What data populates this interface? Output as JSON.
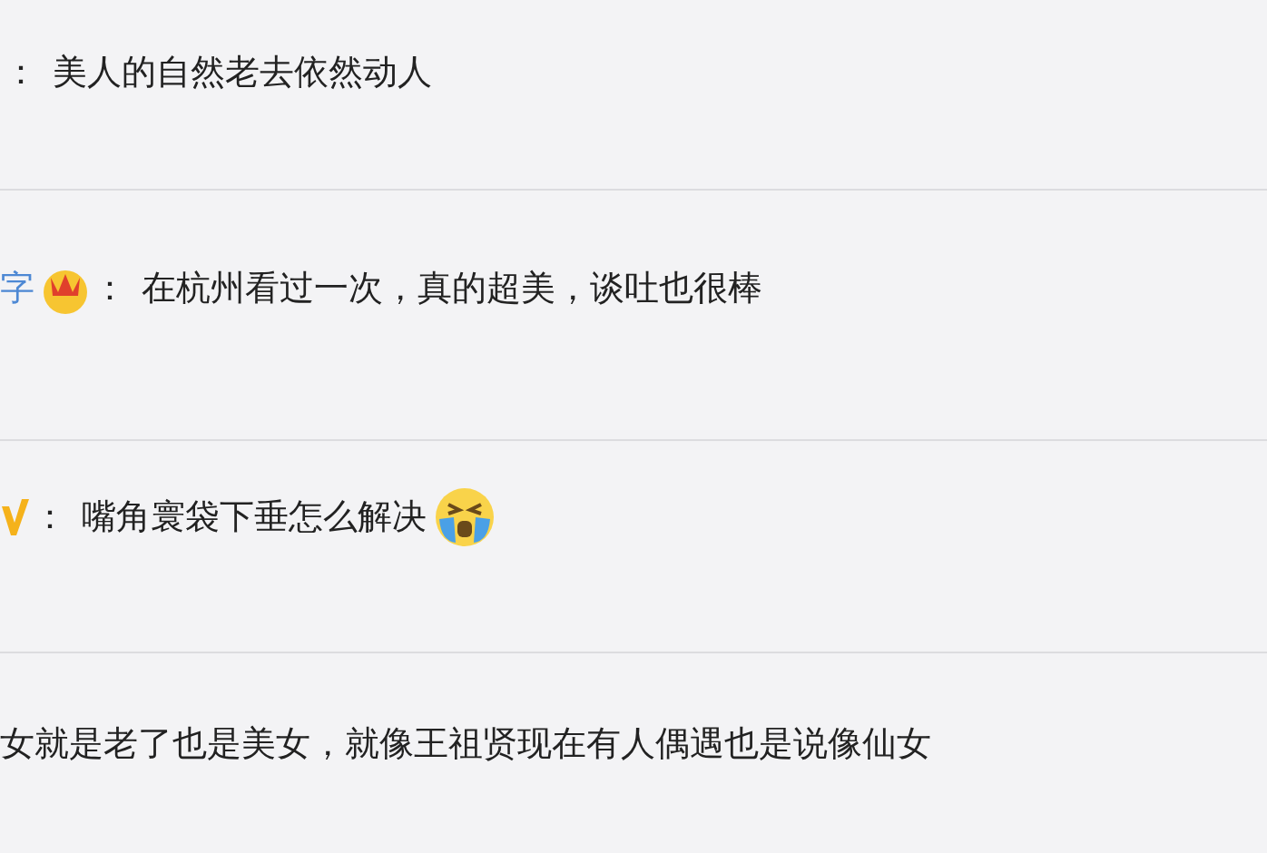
{
  "comments": [
    {
      "separator": "：",
      "text": "美人的自然老去依然动人",
      "crown": false,
      "verified": false,
      "crying_emoji": false
    },
    {
      "user": "字",
      "separator": "：",
      "text": "在杭州看过一次，真的超美，谈吐也很棒",
      "crown": true,
      "verified": false,
      "crying_emoji": false
    },
    {
      "separator": "：",
      "text": "嘴角寰袋下垂怎么解决",
      "crown": false,
      "verified": true,
      "crying_emoji": true
    },
    {
      "text": "女就是老了也是美女，就像王祖贤现在有人偶遇也是说像仙女",
      "crown": false,
      "verified": false,
      "crying_emoji": false
    }
  ]
}
